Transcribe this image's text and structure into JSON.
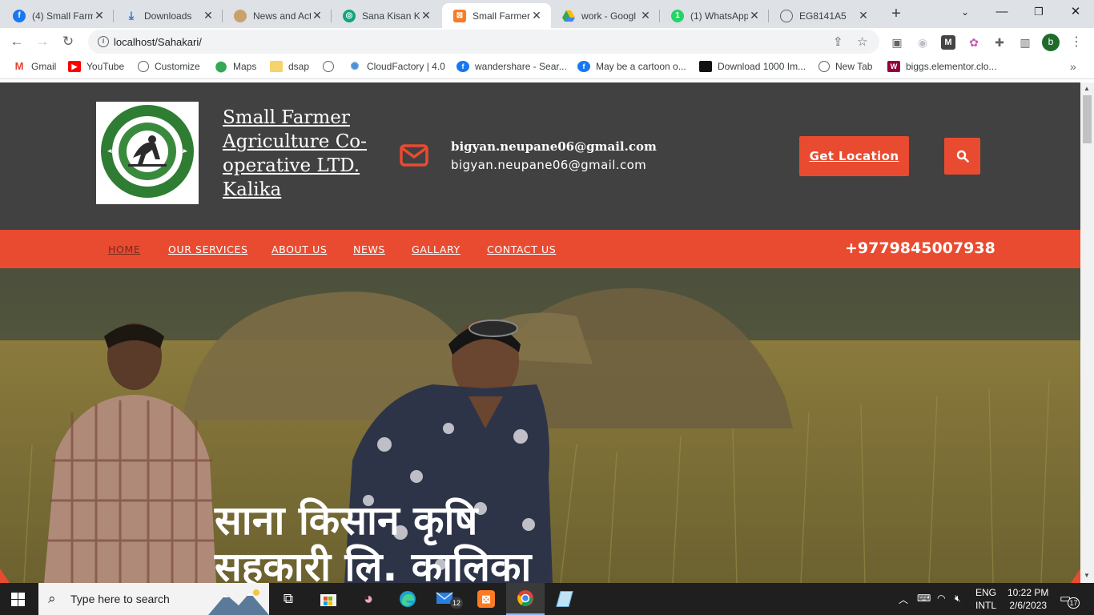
{
  "browser": {
    "tabs": [
      {
        "title": "(4) Small Farm",
        "icon": "facebook-icon",
        "color": "#1877f2"
      },
      {
        "title": "Downloads",
        "icon": "download-icon",
        "color": "#1a73e8"
      },
      {
        "title": "News and Act",
        "icon": "site-logo-icon",
        "color": "#6b8e23"
      },
      {
        "title": "Sana Kisan Kr",
        "icon": "chatgpt-icon",
        "color": "#10a37f"
      },
      {
        "title": "Small Farmer",
        "icon": "xampp-icon",
        "color": "#fb7a24"
      },
      {
        "title": "work - Googl",
        "icon": "google-drive-icon",
        "color": "#fbbc04"
      },
      {
        "title": "(1) WhatsApp",
        "icon": "whatsapp-icon",
        "color": "#25d366"
      },
      {
        "title": "EG8141A5",
        "icon": "globe-icon",
        "color": "#5f6368"
      }
    ],
    "url": "localhost/Sahakari/",
    "bookmarks": [
      {
        "label": "Gmail",
        "icon": "gmail-icon",
        "color": "#ea4335"
      },
      {
        "label": "YouTube",
        "icon": "youtube-icon",
        "color": "#ff0000"
      },
      {
        "label": "Customize",
        "icon": "globe-icon",
        "color": "#5f6368"
      },
      {
        "label": "Maps",
        "icon": "maps-icon",
        "color": "#34a853"
      },
      {
        "label": "dsap",
        "icon": "folder-icon",
        "color": "#f6d36b"
      },
      {
        "label": "",
        "icon": "globe-icon",
        "color": "#5f6368"
      },
      {
        "label": "CloudFactory | 4.0",
        "icon": "cloudfactory-icon",
        "color": "#4a90d9"
      },
      {
        "label": "wandershare - Sear...",
        "icon": "facebook-icon",
        "color": "#1877f2"
      },
      {
        "label": "May be a cartoon o...",
        "icon": "facebook-icon",
        "color": "#1877f2"
      },
      {
        "label": "Download 1000 Im...",
        "icon": "site-icon",
        "color": "#111111"
      },
      {
        "label": "New Tab",
        "icon": "globe-icon",
        "color": "#5f6368"
      },
      {
        "label": "biggs.elementor.clo...",
        "icon": "elementor-icon",
        "color": "#92003b"
      }
    ],
    "profile_initial": "b"
  },
  "site": {
    "title": "Small Farmer Agriculture Co-operative LTD. Kalika",
    "email_bold": "bigyan.neupane06@gmail.com",
    "email_plain": "bigyan.neupane06@gmail.com",
    "location_button": "Get Location",
    "nav": [
      "HOME",
      "OUR SERVICES",
      "ABOUT US",
      "NEWS",
      "GALLARY",
      "CONTACT US"
    ],
    "phone": "+9779845007938",
    "hero_line1": "साना किसान कृषि",
    "hero_line2": "सहकारी लि. कालिका",
    "accent": "#e94b30",
    "header_bg": "#414141"
  },
  "taskbar": {
    "search_placeholder": "Type here to search",
    "lang_top": "ENG",
    "lang_bottom": "INTL",
    "time": "10:22 PM",
    "date": "2/6/2023",
    "notification_count": "17",
    "mail_badge": "12"
  }
}
